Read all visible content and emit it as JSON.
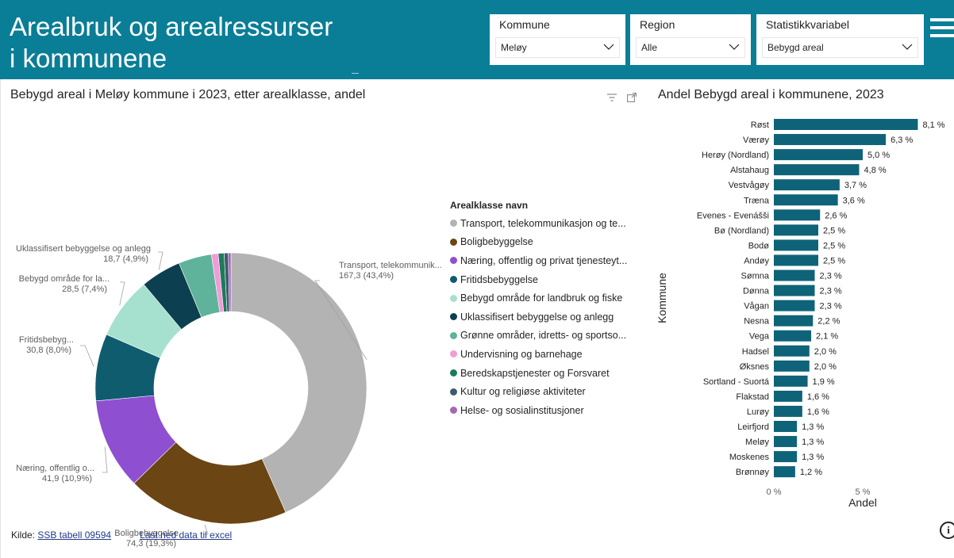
{
  "header": {
    "title_line1": "Arealbruk og arealressurser",
    "title_line2": "i kommunene",
    "accent_color": "#0a7e96"
  },
  "slicers": [
    {
      "label": "Kommune",
      "value": "Meløy"
    },
    {
      "label": "Region",
      "value": "Alle"
    },
    {
      "label": "Statistikkvariabel",
      "value": "Bebygd areal"
    }
  ],
  "icons": {
    "menu": "hamburger-menu-icon",
    "filter": "filter-icon",
    "focus": "focus-mode-icon",
    "slicer_open": "chevron-down-icon",
    "info": "info-icon"
  },
  "footer": {
    "source_prefix": "Kilde: ",
    "source_link": "SSB tabell 09594",
    "download_link": "Last ned data til excel"
  },
  "info_glyph": "i",
  "chart_data": [
    {
      "type": "pie",
      "title": "Bebygd areal i Meløy kommune i 2023, etter arealklasse, andel",
      "legend_title": "Arealklasse navn",
      "legend_placement": "right",
      "slices": [
        {
          "name": "Transport, telekommunikasjon og teknisk infrastruktur",
          "legend_label": "Transport, telekommunikasjon og te...",
          "value": 167.3,
          "percent": 43.4,
          "color": "#b3b3b3",
          "label": "Transport, telekommunik...",
          "value_label": "167,3 (43,4%)"
        },
        {
          "name": "Boligbebyggelse",
          "legend_label": "Boligbebyggelse",
          "value": 74.3,
          "percent": 19.3,
          "color": "#6b4513",
          "label": "Boligbebyggelse",
          "value_label": "74,3 (19,3%)"
        },
        {
          "name": "Næring, offentlig og privat tjenesteyting",
          "legend_label": "Næring, offentlig og privat tjenesteyt...",
          "value": 41.9,
          "percent": 10.9,
          "color": "#8e4fd1",
          "label": "Næring, offentlig o...",
          "value_label": "41,9 (10,9%)"
        },
        {
          "name": "Fritidsbebyggelse",
          "legend_label": "Fritidsbebyggelse",
          "value": 30.8,
          "percent": 8.0,
          "color": "#0f5c6e",
          "label": "Fritidsbebyg...",
          "value_label": "30,8 (8,0%)"
        },
        {
          "name": "Bebygd område for landbruk og fiske",
          "legend_label": "Bebygd område for landbruk og fiske",
          "value": 28.5,
          "percent": 7.4,
          "color": "#a6e0cf",
          "label": "Bebygd område for la...",
          "value_label": "28,5 (7,4%)"
        },
        {
          "name": "Uklassifisert bebyggelse og anlegg",
          "legend_label": "Uklassifisert bebyggelse og anlegg",
          "value": 18.7,
          "percent": 4.9,
          "color": "#0c3f50",
          "label": "Uklassifisert bebyggelse og anlegg",
          "value_label": "18,7 (4,9%)"
        },
        {
          "name": "Grønne områder, idretts- og sportsområder",
          "legend_label": "Grønne områder, idretts- og sportso...",
          "value": 15.2,
          "percent": 4.0,
          "color": "#5fb39a",
          "label": "",
          "value_label": ""
        },
        {
          "name": "Undervisning og barnehage",
          "legend_label": "Undervisning og barnehage",
          "value": 3.1,
          "percent": 0.8,
          "color": "#f29bd8",
          "label": "",
          "value_label": ""
        },
        {
          "name": "Beredskapstjenester og Forsvaret",
          "legend_label": "Beredskapstjenester og Forsvaret",
          "value": 2.7,
          "percent": 0.7,
          "color": "#1d7a5a",
          "label": "",
          "value_label": ""
        },
        {
          "name": "Kultur og religiøse aktiviteter",
          "legend_label": "Kultur og religiøse aktiviteter",
          "value": 1.9,
          "percent": 0.5,
          "color": "#3f5a6e",
          "label": "",
          "value_label": ""
        },
        {
          "name": "Helse- og sosialinstitusjoner",
          "legend_label": "Helse- og sosialinstitusjoner",
          "value": 1.2,
          "percent": 0.3,
          "color": "#a565b8",
          "label": "",
          "value_label": ""
        }
      ]
    },
    {
      "type": "bar",
      "orientation": "horizontal",
      "title": "Andel Bebygd areal i kommunene, 2023",
      "xlabel": "Andel",
      "ylabel": "Kommune",
      "xlim": [
        0,
        9
      ],
      "x_ticks": [
        {
          "value": 0,
          "label": "0 %"
        },
        {
          "value": 5,
          "label": "5 %"
        }
      ],
      "bar_color": "#0f6378",
      "categories": [
        "Røst",
        "Værøy",
        "Herøy (Nordland)",
        "Alstahaug",
        "Vestvågøy",
        "Træna",
        "Evenes - Evenášši",
        "Bø (Nordland)",
        "Bodø",
        "Andøy",
        "Sømna",
        "Dønna",
        "Vågan",
        "Nesna",
        "Vega",
        "Hadsel",
        "Øksnes",
        "Sortland - Suortá",
        "Flakstad",
        "Lurøy",
        "Leirfjord",
        "Meløy",
        "Moskenes",
        "Brønnøy"
      ],
      "values": [
        8.1,
        6.3,
        5.0,
        4.8,
        3.7,
        3.6,
        2.6,
        2.5,
        2.5,
        2.5,
        2.3,
        2.3,
        2.3,
        2.2,
        2.1,
        2.0,
        2.0,
        1.9,
        1.6,
        1.6,
        1.3,
        1.3,
        1.3,
        1.2
      ],
      "value_labels": [
        "8,1 %",
        "6,3 %",
        "5,0 %",
        "4,8 %",
        "3,7 %",
        "3,6 %",
        "2,6 %",
        "2,5 %",
        "2,5 %",
        "2,5 %",
        "2,3 %",
        "2,3 %",
        "2,3 %",
        "2,2 %",
        "2,1 %",
        "2,0 %",
        "2,0 %",
        "1,9 %",
        "1,6 %",
        "1,6 %",
        "1,3 %",
        "1,3 %",
        "1,3 %",
        "1,2 %"
      ]
    }
  ]
}
